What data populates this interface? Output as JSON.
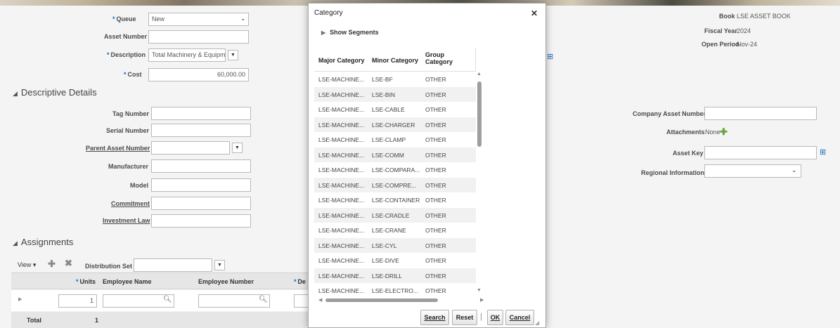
{
  "header": {
    "queue_label": "Queue",
    "queue_value": "New",
    "asset_number_label": "Asset Number",
    "asset_number_value": "",
    "description_label": "Description",
    "description_value": "Total Machinery & Equipmer",
    "cost_label": "Cost",
    "cost_value": "60,000.00",
    "book_label": "Book",
    "book_value": "LSE ASSET BOOK",
    "fiscal_year_label": "Fiscal Year",
    "fiscal_year_value": "2024",
    "open_period_label": "Open Period",
    "open_period_value": "Nov-24"
  },
  "descriptive": {
    "title": "Descriptive Details",
    "tag_number_label": "Tag Number",
    "serial_number_label": "Serial Number",
    "parent_asset_label": "Parent Asset Number",
    "manufacturer_label": "Manufacturer",
    "model_label": "Model",
    "commitment_label": "Commitment",
    "investment_law_label": "Investment Law",
    "company_asset_label": "Company Asset Number",
    "attachments_label": "Attachments",
    "attachments_value": "None",
    "asset_key_label": "Asset Key",
    "regional_info_label": "Regional Information"
  },
  "assignments": {
    "title": "Assignments",
    "view_label": "View",
    "distribution_set_label": "Distribution Set",
    "col_units": "Units",
    "col_employee_name": "Employee Name",
    "col_employee_number": "Employee Number",
    "col_dep": "De",
    "row_units": "1",
    "total_label": "Total",
    "total_value": "1"
  },
  "modal": {
    "title": "Category",
    "show_segments": "Show Segments",
    "col_major": "Major Category",
    "col_minor": "Minor Category",
    "col_group_line1": "Group",
    "col_group_line2": "Category",
    "rows": [
      {
        "major": "LSE-MACHINE...",
        "minor": "LSE-BF",
        "group": "OTHER"
      },
      {
        "major": "LSE-MACHINE...",
        "minor": "LSE-BIN",
        "group": "OTHER"
      },
      {
        "major": "LSE-MACHINE...",
        "minor": "LSE-CABLE",
        "group": "OTHER"
      },
      {
        "major": "LSE-MACHINE...",
        "minor": "LSE-CHARGER",
        "group": "OTHER"
      },
      {
        "major": "LSE-MACHINE...",
        "minor": "LSE-CLAMP",
        "group": "OTHER"
      },
      {
        "major": "LSE-MACHINE...",
        "minor": "LSE-COMM",
        "group": "OTHER"
      },
      {
        "major": "LSE-MACHINE...",
        "minor": "LSE-COMPARA...",
        "group": "OTHER"
      },
      {
        "major": "LSE-MACHINE...",
        "minor": "LSE-COMPRE...",
        "group": "OTHER"
      },
      {
        "major": "LSE-MACHINE...",
        "minor": "LSE-CONTAINER",
        "group": "OTHER"
      },
      {
        "major": "LSE-MACHINE...",
        "minor": "LSE-CRADLE",
        "group": "OTHER"
      },
      {
        "major": "LSE-MACHINE...",
        "minor": "LSE-CRANE",
        "group": "OTHER"
      },
      {
        "major": "LSE-MACHINE...",
        "minor": "LSE-CYL",
        "group": "OTHER"
      },
      {
        "major": "LSE-MACHINE...",
        "minor": "LSE-DIVE",
        "group": "OTHER"
      },
      {
        "major": "LSE-MACHINE...",
        "minor": "LSE-DRILL",
        "group": "OTHER"
      },
      {
        "major": "LSE-MACHINE...",
        "minor": "LSE-ELECTRO...",
        "group": "OTHER"
      }
    ],
    "search_label": "Search",
    "reset_label": "Reset",
    "ok_label": "OK",
    "cancel_label": "Cancel"
  }
}
